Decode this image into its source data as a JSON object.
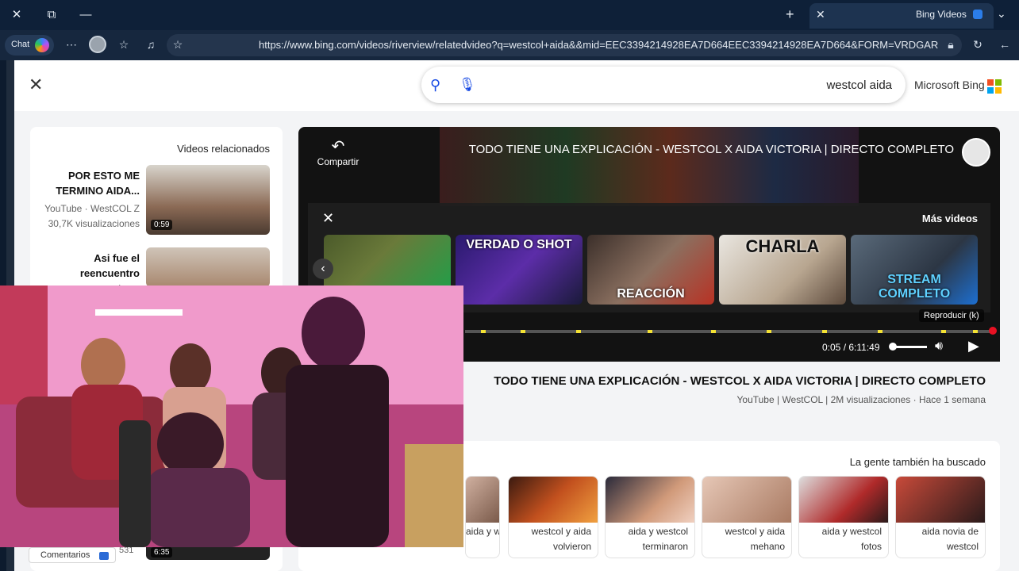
{
  "browser": {
    "tab_title": "Bing Videos",
    "url": "https://www.bing.com/videos/riverview/relatedvideo?q=westcol+aida&&mid=EEC3394214928EA7D664EEC3394214928EA7D664&FORM=VRDGAR",
    "chat_label": "Chat",
    "icons": [
      "close-icon",
      "restore-icon",
      "minimize-icon",
      "new-tab-icon",
      "favorites-icon",
      "reading-icon",
      "more-icon",
      "refresh-icon",
      "back-icon"
    ]
  },
  "search": {
    "brand": "Microsoft Bing",
    "query": "westcol aida",
    "logo_colors": [
      "#f25022",
      "#7fba00",
      "#00a4ef",
      "#ffb900"
    ]
  },
  "player": {
    "title": "TODO TIENE UNA EXPLICACIÓN - WESTCOL X AIDA VICTORIA | DIRECTO COMPLETO",
    "share": "Compartir",
    "more_videos": "Más videos",
    "play_tooltip": "Reproducir (k)",
    "time": "0:05 / 6:11:49",
    "progress_fraction": 0.0002,
    "more_captions": [
      "STREAM COMPLETO",
      "CHARLA",
      "REACCIÓN",
      "VERDAD O SHOT",
      ""
    ]
  },
  "video_info": {
    "title": "TODO TIENE UNA EXPLICACIÓN - WESTCOL X AIDA VICTORIA | DIRECTO COMPLETO",
    "meta": "YouTube  |  WestCOL  |  2M visualizaciones  ·  Hace 1 semana"
  },
  "related": {
    "title": "Videos relacionados",
    "items": [
      {
        "title": "POR ESTO ME TERMINO AIDA...",
        "meta1": "YouTube · WestCOL Z",
        "meta2": "30,7K visualizaciones",
        "duration": "0:59"
      },
      {
        "title": "Asi fue el reencuentro entre...",
        "meta1": "",
        "meta2": "",
        "duration": ""
      },
      {
        "title": "",
        "meta1": "",
        "meta2": "531",
        "duration": "6:35"
      }
    ],
    "comments": "Comentarios"
  },
  "people_searched": {
    "title": "La gente también ha buscado",
    "items": [
      {
        "label": "aida novia de westcol"
      },
      {
        "label": "aida y westcol fotos"
      },
      {
        "label": "westcol y aida mehano"
      },
      {
        "label": "aida y westcol terminaron"
      },
      {
        "label": "westcol y aida volvieron"
      },
      {
        "label": "aida y westcol ruptura"
      }
    ]
  }
}
